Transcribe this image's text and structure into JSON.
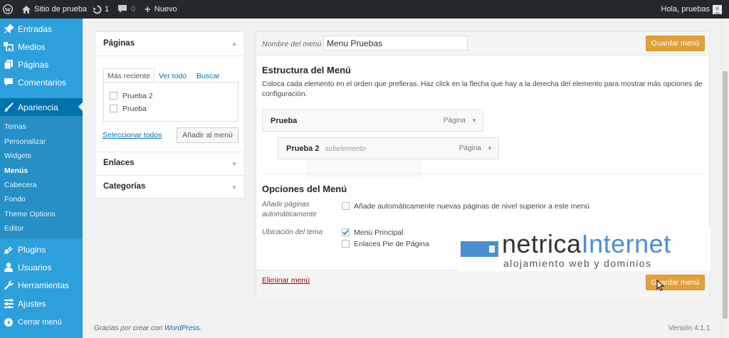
{
  "adminbar": {
    "site_name": "Sitio de prueba",
    "updates_count": "1",
    "comments_count": "0",
    "new_label": "Nuevo",
    "greeting": "Hola, pruebas"
  },
  "sidebar": {
    "items": [
      {
        "label": "Entradas",
        "icon": "pin-icon"
      },
      {
        "label": "Medios",
        "icon": "media-icon"
      },
      {
        "label": "Páginas",
        "icon": "pages-icon"
      },
      {
        "label": "Comentarios",
        "icon": "comment-icon"
      },
      {
        "label": "Apariencia",
        "icon": "brush-icon"
      },
      {
        "label": "Plugins",
        "icon": "plug-icon"
      },
      {
        "label": "Usuarios",
        "icon": "user-icon"
      },
      {
        "label": "Herramientas",
        "icon": "wrench-icon"
      },
      {
        "label": "Ajustes",
        "icon": "settings-icon"
      },
      {
        "label": "Cerrar menú",
        "icon": "collapse-icon"
      }
    ],
    "submenu": [
      "Temas",
      "Personalizar",
      "Widgets",
      "Menús",
      "Cabecera",
      "Fondo",
      "Theme Options",
      "Editor"
    ]
  },
  "left": {
    "pages_title": "Páginas",
    "tabs": [
      "Más reciente",
      "Ver todo",
      "Buscar"
    ],
    "pages": [
      "Prueba 2",
      "Prueba"
    ],
    "select_all": "Seleccionar todos",
    "add_button": "Añadir al menú",
    "links_title": "Enlaces",
    "categories_title": "Categorías"
  },
  "main": {
    "menu_name_label": "Nombre del menú",
    "menu_name_value": "Menu Pruebas",
    "save_label": "Guardar menú",
    "structure_title": "Estructura del Menú",
    "structure_desc": "Coloca cada elemento en el orden que prefieras. Haz click en la flecha que hay a la derecha del elemento para mostrar más opciones de configuración.",
    "items": [
      {
        "title": "Prueba",
        "sub": "",
        "type": "Página"
      },
      {
        "title": "Prueba 2",
        "sub": "subelemento",
        "type": "Página"
      }
    ],
    "options_title": "Opciones del Menú",
    "auto_add_label": "Añadir páginas automáticamente",
    "auto_add_text": "Añade automáticamente nuevas páginas de nivel superior a este menú",
    "location_label": "Ubicación del tema",
    "locations": [
      {
        "label": "Menú Principal",
        "checked": true
      },
      {
        "label": "Enlaces Pie de Página",
        "checked": false
      }
    ],
    "delete_label": "Eliminar menú"
  },
  "footer": {
    "thanks_prefix": "Gracias por crear con",
    "wp_link": "WordPress",
    "version": "Versión 4.1.1"
  },
  "watermark": {
    "brand_a": "netrica",
    "brand_b": "Internet",
    "tagline": "alojamiento web y dominios"
  },
  "colors": {
    "sidebar": "#2ca0dc",
    "accent": "#0073aa",
    "primary_button": "#e2a038",
    "adminbar": "#23282d"
  }
}
